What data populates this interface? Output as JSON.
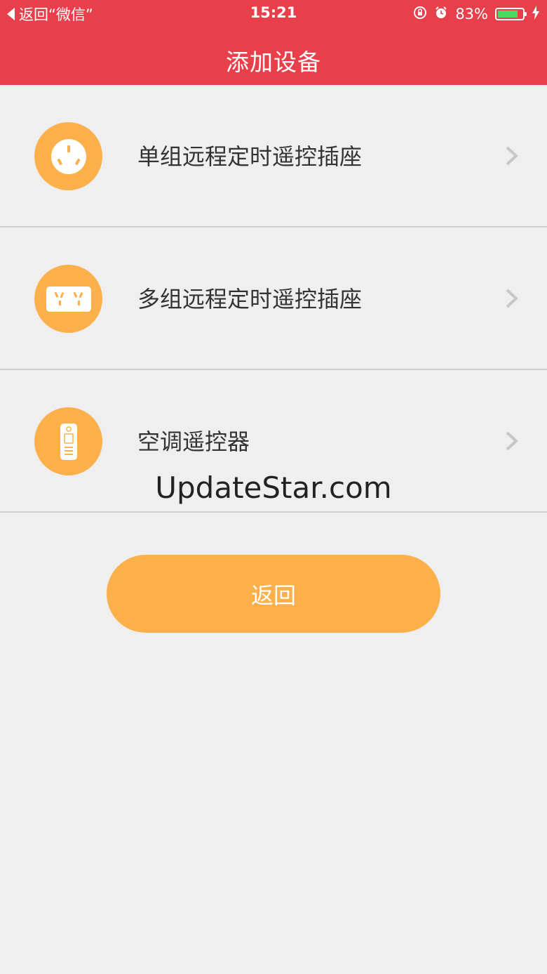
{
  "status_bar": {
    "back_label": "返回“微信”",
    "time": "15:21",
    "battery_percent": "83%",
    "battery_level": 0.83,
    "icons": [
      "orientation-lock-icon",
      "alarm-icon",
      "battery-icon",
      "charging-icon"
    ]
  },
  "header": {
    "title": "添加设备"
  },
  "devices": [
    {
      "label": "单组远程定时遥控插座",
      "icon": "single-socket-icon"
    },
    {
      "label": "多组远程定时遥控插座",
      "icon": "multi-socket-icon"
    },
    {
      "label": "空调遥控器",
      "icon": "ac-remote-icon"
    }
  ],
  "watermark": "UpdateStar.com",
  "back_button": "返回",
  "colors": {
    "header": "#e8404b",
    "accent": "#fcb04c",
    "background": "#efefef"
  }
}
